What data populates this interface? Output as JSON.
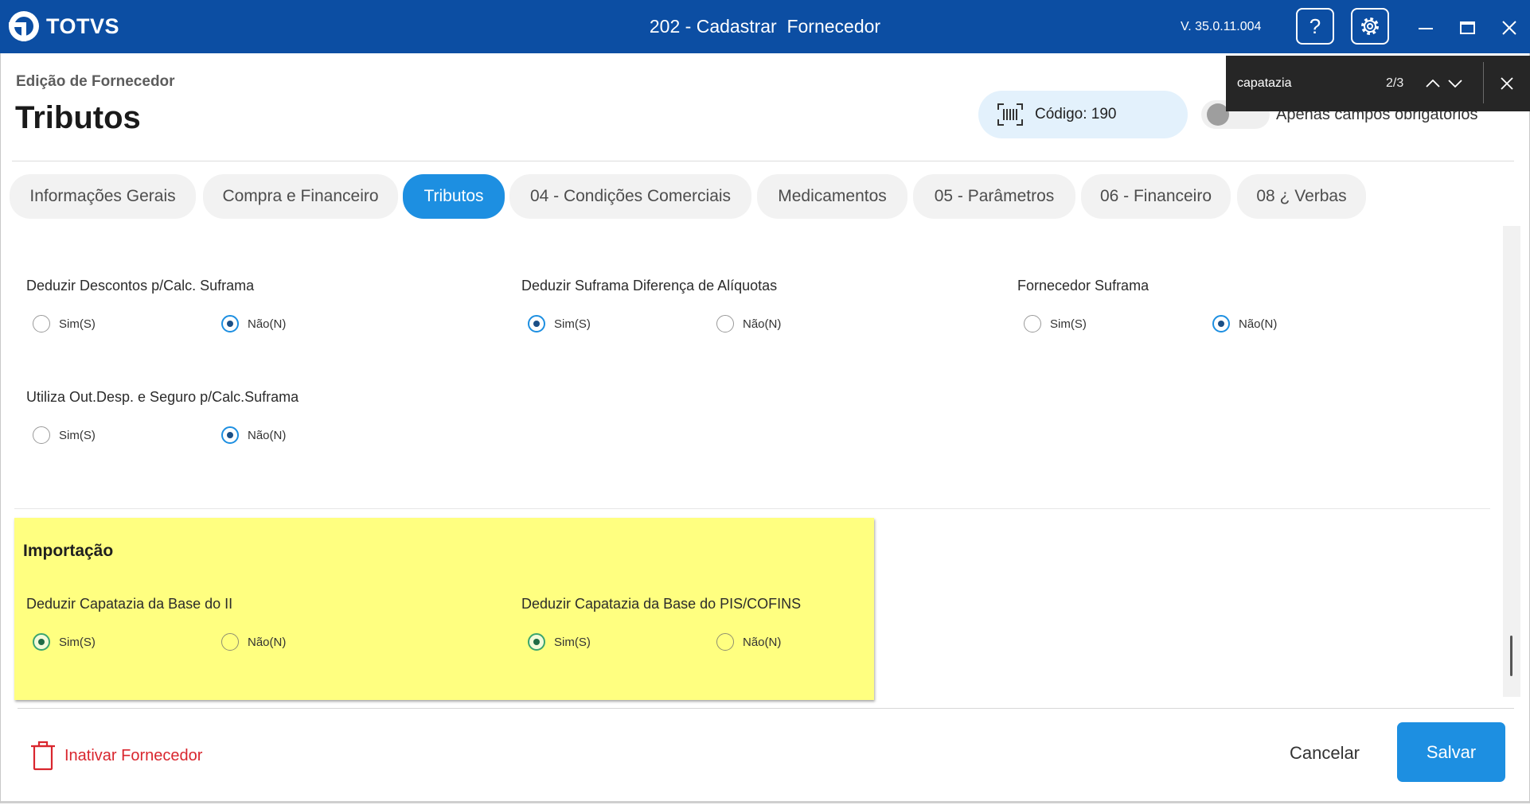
{
  "theme": {
    "titlebar_color": "#0c4ea3",
    "accent_color": "#1d8fe1",
    "danger_color": "#d9262e",
    "highlight_color": "#ffff80"
  },
  "titlebar": {
    "logo_text": "TOTVS",
    "title": "202 - Cadastrar  Fornecedor",
    "version": "V. 35.0.11.004",
    "help_label": "?"
  },
  "find_bar": {
    "query": "capatazia",
    "match_counter": "2/3"
  },
  "header": {
    "breadcrumb": "Edição de Fornecedor",
    "title": "Tributos",
    "code_label": "Código: 190",
    "required_only_label": "Apenas campos obrigatórios",
    "required_only_enabled": false
  },
  "tabs": [
    {
      "label": "Informações Gerais",
      "active": false
    },
    {
      "label": "Compra e Financeiro",
      "active": false
    },
    {
      "label": "Tributos",
      "active": true
    },
    {
      "label": "04 - Condições Comerciais",
      "active": false
    },
    {
      "label": "Medicamentos",
      "active": false
    },
    {
      "label": "05 - Parâmetros",
      "active": false
    },
    {
      "label": "06 - Financeiro",
      "active": false
    },
    {
      "label": "08 ¿ Verbas",
      "active": false
    }
  ],
  "fields": [
    {
      "label": "Deduzir Descontos p/Calc. Suframa",
      "options": [
        {
          "label": "Sim(S)",
          "selected": false
        },
        {
          "label": "Não(N)",
          "selected": true
        }
      ]
    },
    {
      "label": "Deduzir Suframa Diferença de Alíquotas",
      "options": [
        {
          "label": "Sim(S)",
          "selected": true
        },
        {
          "label": "Não(N)",
          "selected": false
        }
      ]
    },
    {
      "label": "Fornecedor Suframa",
      "options": [
        {
          "label": "Sim(S)",
          "selected": false
        },
        {
          "label": "Não(N)",
          "selected": true
        }
      ]
    },
    {
      "label": "Utiliza Out.Desp. e Seguro p/Calc.Suframa",
      "options": [
        {
          "label": "Sim(S)",
          "selected": false
        },
        {
          "label": "Não(N)",
          "selected": true
        }
      ]
    }
  ],
  "importacao": {
    "title": "Importação",
    "fields": [
      {
        "label": "Deduzir Capatazia da Base do II",
        "options": [
          {
            "label": "Sim(S)",
            "selected": true
          },
          {
            "label": "Não(N)",
            "selected": false
          }
        ]
      },
      {
        "label": "Deduzir Capatazia da Base do PIS/COFINS",
        "options": [
          {
            "label": "Sim(S)",
            "selected": true
          },
          {
            "label": "Não(N)",
            "selected": false
          }
        ]
      }
    ]
  },
  "footer": {
    "inactivate_label": "Inativar Fornecedor",
    "cancel_label": "Cancelar",
    "save_label": "Salvar"
  }
}
